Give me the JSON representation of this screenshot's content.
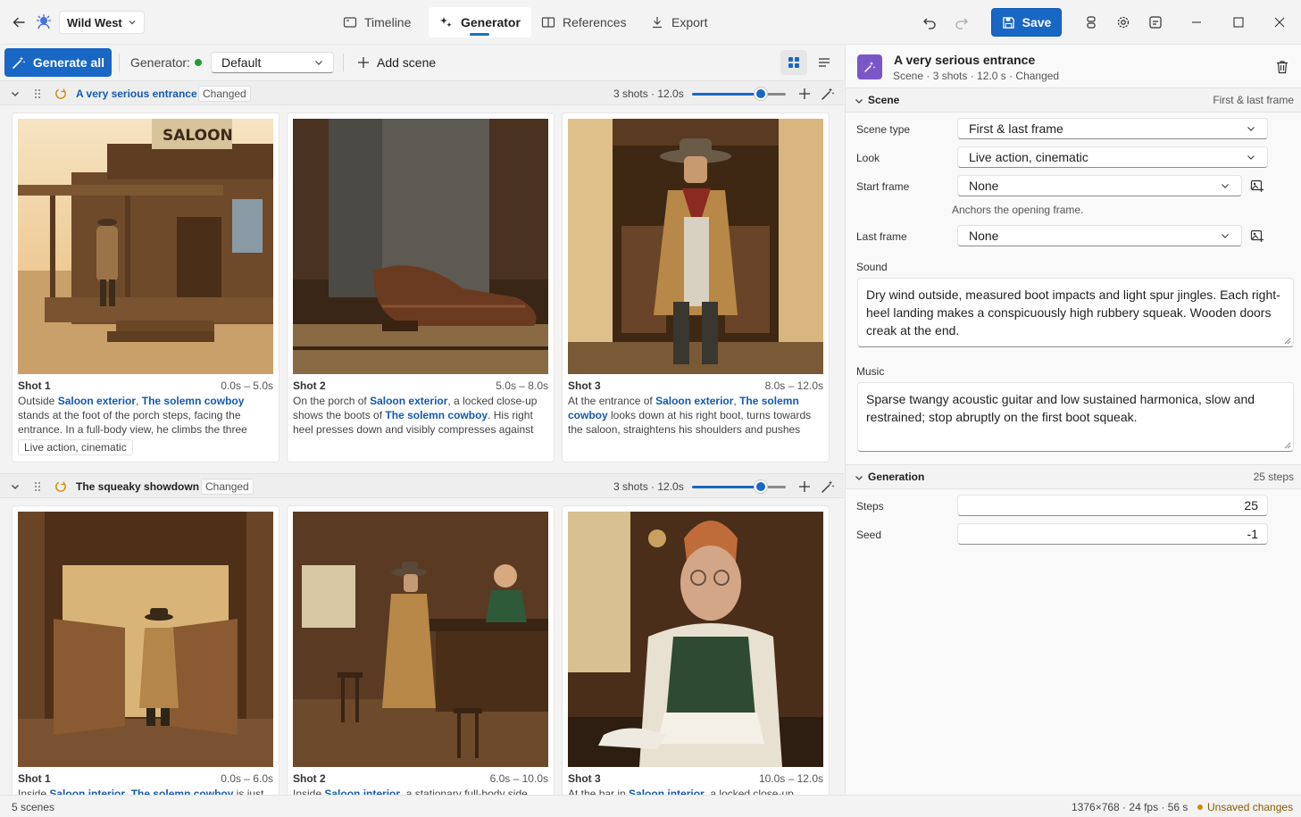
{
  "titlebar": {
    "project": "Wild West",
    "tabs": [
      {
        "label": "Timeline",
        "icon": "timeline-icon"
      },
      {
        "label": "Generator",
        "icon": "sparkle-icon"
      },
      {
        "label": "References",
        "icon": "book-icon"
      },
      {
        "label": "Export",
        "icon": "download-icon"
      }
    ],
    "active_tab": "Generator",
    "save_label": "Save"
  },
  "toolbar": {
    "generate_all_label": "Generate all",
    "generator_label": "Generator:",
    "generator_status_color": "#1f9d3a",
    "generator_value": "Default",
    "add_scene_label": "Add scene"
  },
  "scenes": [
    {
      "title": "A very serious entrance",
      "badge": "Changed",
      "summary": "3 shots · 12.0s",
      "duration_level": 0.8,
      "shots": [
        {
          "title": "Shot 1",
          "time": "0.0s – 5.0s",
          "desc": [
            {
              "t": "Outside "
            },
            {
              "t": "Saloon exterior",
              "ref": true
            },
            {
              "t": ", "
            },
            {
              "t": "The solemn cowboy",
              "ref": true
            },
            {
              "t": " stands at the foot of the porch steps, facing the entrance. In a full-body view, he climbs the three steps with…"
            }
          ],
          "tag": "Live action, cinematic"
        },
        {
          "title": "Shot 2",
          "time": "5.0s – 8.0s",
          "desc": [
            {
              "t": "On the porch of "
            },
            {
              "t": "Saloon exterior",
              "ref": true
            },
            {
              "t": ", a locked close-up shows the boots of "
            },
            {
              "t": "The solemn cowboy",
              "ref": true
            },
            {
              "t": ". His right heel presses down and visibly compresses against t…"
            }
          ]
        },
        {
          "title": "Shot 3",
          "time": "8.0s – 12.0s",
          "desc": [
            {
              "t": "At the entrance of "
            },
            {
              "t": "Saloon exterior",
              "ref": true
            },
            {
              "t": ", "
            },
            {
              "t": "The solemn cowboy",
              "ref": true
            },
            {
              "t": " looks down at his right boot, turns towards the saloon, straightens his shoulders and pushes bo…"
            }
          ]
        }
      ]
    },
    {
      "title": "The squeaky showdown",
      "badge": "Changed",
      "summary": "3 shots · 12.0s",
      "duration_level": 0.8,
      "shots": [
        {
          "title": "Shot 1",
          "time": "0.0s – 6.0s",
          "desc": [
            {
              "t": "Inside "
            },
            {
              "t": "Saloon interior",
              "ref": true
            },
            {
              "t": ", "
            },
            {
              "t": "The solemn cowboy",
              "ref": true
            },
            {
              "t": " is just"
            }
          ]
        },
        {
          "title": "Shot 2",
          "time": "6.0s – 10.0s",
          "desc": [
            {
              "t": "Inside "
            },
            {
              "t": "Saloon interior",
              "ref": true
            },
            {
              "t": ", a stationary full-body side view"
            }
          ]
        },
        {
          "title": "Shot 3",
          "time": "10.0s – 12.0s",
          "desc": [
            {
              "t": "At the bar in "
            },
            {
              "t": "Saloon interior",
              "ref": true
            },
            {
              "t": ", a locked close-up shows"
            }
          ]
        }
      ]
    }
  ],
  "inspector": {
    "title": "A very serious entrance",
    "subtitle": "Scene · 3 shots · 12.0 s · Changed",
    "scene_section": {
      "title": "Scene",
      "meta": "First & last frame",
      "scene_type_label": "Scene type",
      "scene_type_value": "First & last frame",
      "look_label": "Look",
      "look_value": "Live action, cinematic",
      "start_frame_label": "Start frame",
      "start_frame_value": "None",
      "start_frame_hint": "Anchors the opening frame.",
      "last_frame_label": "Last frame",
      "last_frame_value": "None",
      "sound_label": "Sound",
      "sound_value": "Dry wind outside, measured boot impacts and light spur jingles. Each right-heel landing makes a conspicuously high rubbery squeak. Wooden doors creak at the end.",
      "music_label": "Music",
      "music_value": "Sparse twangy acoustic guitar and low sustained harmonica, slow and restrained; stop abruptly on the first boot squeak."
    },
    "generation_section": {
      "title": "Generation",
      "meta": "25 steps",
      "steps_label": "Steps",
      "steps_value": "25",
      "seed_label": "Seed",
      "seed_value": "-1"
    }
  },
  "statusbar": {
    "left": "5 scenes",
    "right": "1376×768 · 24 fps · 56 s",
    "unsaved": "Unsaved changes",
    "unsaved_color": "#d18a00"
  },
  "colors": {
    "accent": "#1967c4",
    "reference_text": "#1559b0",
    "generator_icon_bg": "#7a57c9"
  }
}
